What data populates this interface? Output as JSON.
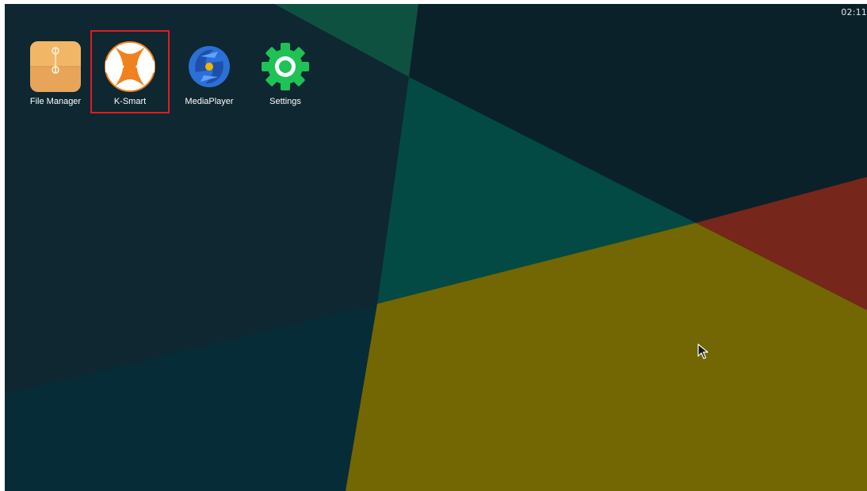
{
  "status_bar": {
    "clock": "02:11"
  },
  "desktop": {
    "apps": [
      {
        "label": "File Manager",
        "icon": "folder-icon",
        "color": "#e8a55a"
      },
      {
        "label": "K-Smart",
        "icon": "k-smart-icon",
        "color": "#f0821e",
        "selected": true
      },
      {
        "label": "MediaPlayer",
        "icon": "media-player-icon",
        "color": "#2c6fd6"
      },
      {
        "label": "Settings",
        "icon": "gear-icon",
        "color": "#1fc255"
      }
    ]
  },
  "colors": {
    "highlight": "#e11b22",
    "wallpaper_teal": "#034a44",
    "wallpaper_olive": "#726702",
    "wallpaper_red": "#76261b",
    "wallpaper_dark": "#0b232b"
  }
}
